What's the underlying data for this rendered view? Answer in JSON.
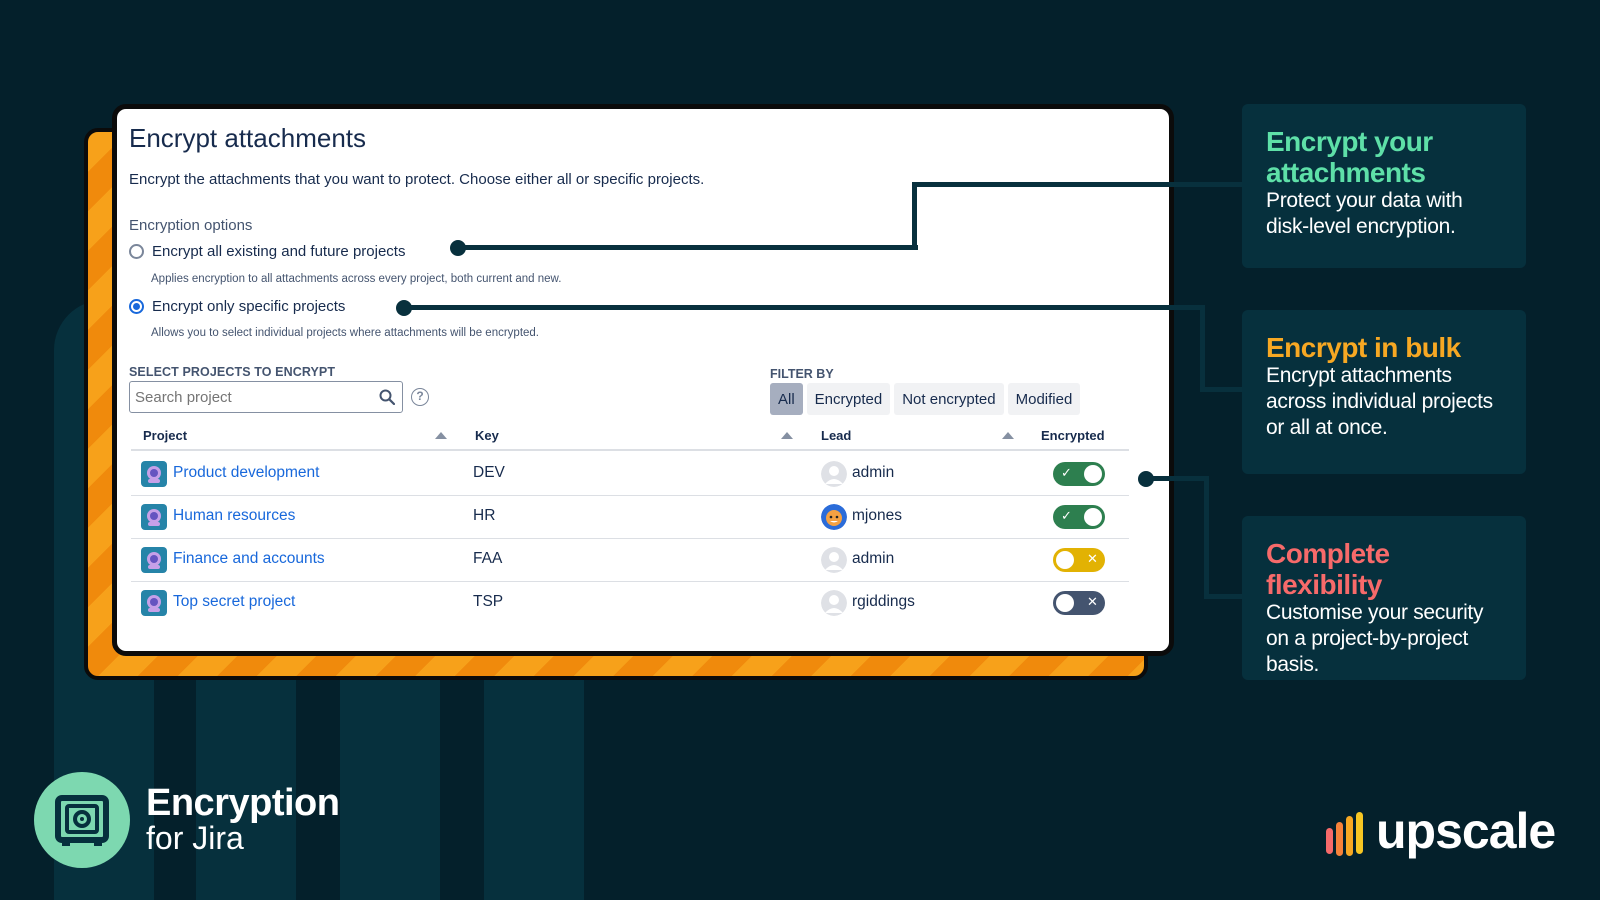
{
  "card": {
    "title": "Encrypt attachments",
    "description": "Encrypt the attachments that you want to protect. Choose either all or specific projects.",
    "options_label": "Encryption options",
    "option_all": {
      "label": "Encrypt all existing and future projects",
      "help": "Applies encryption to all attachments across every project, both current and new.",
      "selected": false
    },
    "option_specific": {
      "label": "Encrypt only specific projects",
      "help": "Allows you to select individual projects where attachments will be encrypted.",
      "selected": true
    },
    "select_label": "SELECT PROJECTS TO ENCRYPT",
    "search_placeholder": "Search project",
    "filter_label": "FILTER BY",
    "filters": [
      "All",
      "Encrypted",
      "Not encrypted",
      "Modified"
    ],
    "active_filter": "All",
    "columns": [
      "Project",
      "Key",
      "Lead",
      "Encrypted"
    ],
    "rows": [
      {
        "project": "Product development",
        "key": "DEV",
        "lead": "admin",
        "encrypted": "on"
      },
      {
        "project": "Human resources",
        "key": "HR",
        "lead": "mjones",
        "encrypted": "on"
      },
      {
        "project": "Finance and accounts",
        "key": "FAA",
        "lead": "admin",
        "encrypted": "modified-off"
      },
      {
        "project": "Top secret project",
        "key": "TSP",
        "lead": "rgiddings",
        "encrypted": "off"
      }
    ]
  },
  "callouts": [
    {
      "title": "Encrypt your attachments",
      "body": "Protect your data with disk-level encryption.",
      "color": "#5ee0a8"
    },
    {
      "title": "Encrypt in bulk",
      "body": "Encrypt attachments across individual projects or all at once.",
      "color": "#f7a823"
    },
    {
      "title": "Complete flexibility",
      "body": "Customise your security on a project-by-project basis.",
      "color": "#f76a6a"
    }
  ],
  "brand": {
    "title": "Encryption",
    "subtitle": "for Jira",
    "company": "upscale"
  },
  "colors": {
    "background": "#04202b",
    "accent_blue": "#1868db",
    "toggle_on": "#2d7f4f",
    "toggle_modified": "#e2b203",
    "toggle_off": "#44546f"
  },
  "icons": {
    "toggle_on": "✓",
    "toggle_off": "✕"
  }
}
